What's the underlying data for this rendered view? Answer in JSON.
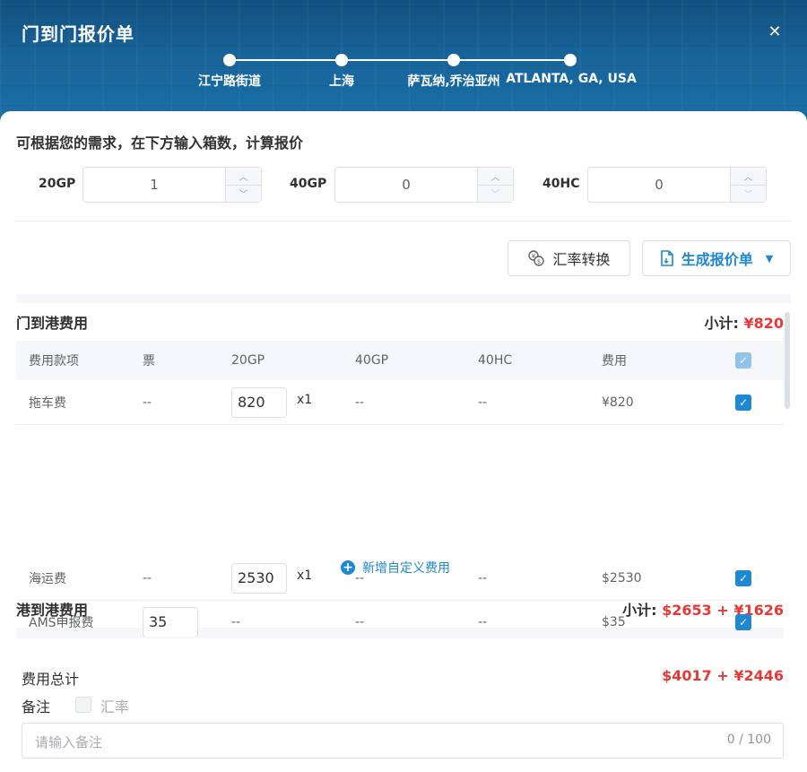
{
  "dialog": {
    "title": "门到门报价单",
    "close_icon": "close-icon"
  },
  "route": {
    "stops": [
      "江宁路街道",
      "上海",
      "萨瓦纳,乔治亚州",
      "ATLANTA, GA, USA"
    ]
  },
  "quantities": {
    "hint": "可根据您的需求，在下方输入箱数，计算报价",
    "items": [
      {
        "label": "20GP",
        "value": "1"
      },
      {
        "label": "40GP",
        "value": "0"
      },
      {
        "label": "40HC",
        "value": "0"
      }
    ]
  },
  "toolbar": {
    "exchange_label": "汇率转换",
    "exchange_icon": "currency-exchange-icon",
    "generate_label": "生成报价单",
    "generate_icon": "document-icon"
  },
  "columns": [
    "费用款项",
    "票",
    "20GP",
    "40GP",
    "40HC",
    "费用"
  ],
  "section_door_port": {
    "title": "门到港费用",
    "subtotal_label": "小计:",
    "subtotal_value": "¥820",
    "rows": [
      {
        "name": "拖车费",
        "ticket": "--",
        "gp20": "820",
        "gp20_mult": "x1",
        "gp40": "--",
        "hc40": "--",
        "fee": "¥820"
      }
    ],
    "add_custom": "新增自定义费用"
  },
  "section_port_port": {
    "title": "港到港费用",
    "subtotal_label": "小计:",
    "subtotal_value": "$2653 + ¥1626",
    "rows": [
      {
        "name": "海运费",
        "ticket": "--",
        "gp20": "2530",
        "gp20_mult": "x1",
        "gp40": "--",
        "hc40": "--",
        "fee": "$2530"
      },
      {
        "name": "AMS申报费",
        "ticket": "35",
        "gp20": "--",
        "gp40": "--",
        "hc40": "--",
        "fee": "$35"
      }
    ]
  },
  "footer": {
    "total_label": "费用总计",
    "total_value": "$4017 + ¥2446",
    "remark_label": "备注",
    "fx_label": "汇率",
    "remark_placeholder": "请输入备注",
    "remark_count": "0 / 100"
  },
  "colors": {
    "accent": "#1e88d2",
    "danger": "#e53935",
    "header": "#17649a"
  }
}
